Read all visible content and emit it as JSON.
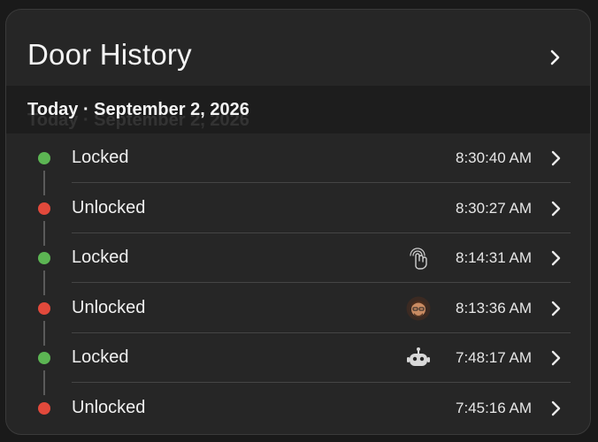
{
  "header": {
    "title": "Door History"
  },
  "section": {
    "label": "Today · September 2, 2026"
  },
  "events": [
    {
      "status": "Locked",
      "time": "8:30:40 AM",
      "color": "#5cb553",
      "actor_icon": ""
    },
    {
      "status": "Unlocked",
      "time": "8:30:27 AM",
      "color": "#e2493b",
      "actor_icon": ""
    },
    {
      "status": "Locked",
      "time": "8:14:31 AM",
      "color": "#5cb553",
      "actor_icon": "touch-icon"
    },
    {
      "status": "Unlocked",
      "time": "8:13:36 AM",
      "color": "#e2493b",
      "actor_icon": "user-avatar"
    },
    {
      "status": "Locked",
      "time": "7:48:17 AM",
      "color": "#5cb553",
      "actor_icon": "robot-icon"
    },
    {
      "status": "Unlocked",
      "time": "7:45:16 AM",
      "color": "#e2493b",
      "actor_icon": ""
    }
  ],
  "colors": {
    "background": "#262626",
    "locked": "#5cb553",
    "unlocked": "#e2493b",
    "divider": "#454545"
  }
}
